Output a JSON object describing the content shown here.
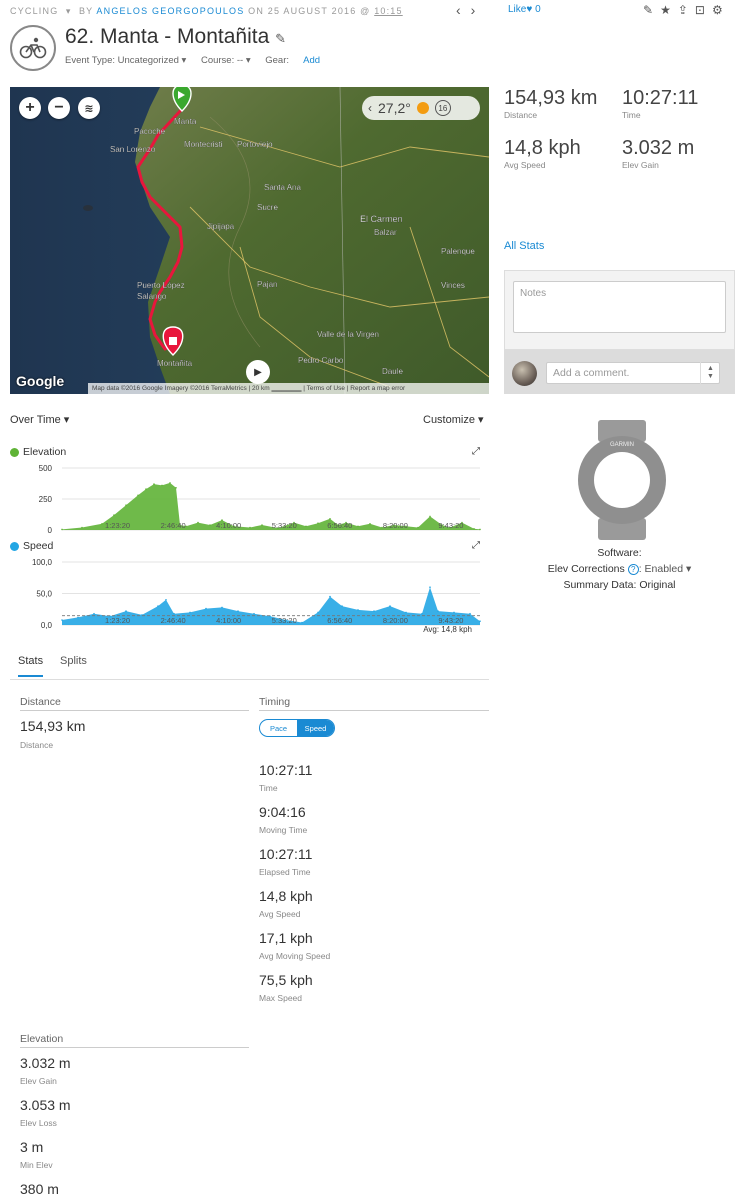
{
  "header": {
    "activity_type": "CYCLING",
    "by": "BY",
    "author": "ANGELOS GEORGOPOULOS",
    "date_prefix": "ON 25 AUGUST 2016 @",
    "time": "10:15",
    "like_label": "Like",
    "like_count": "0",
    "title": "62. Manta - Montañita",
    "event_type": "Event Type: Uncategorized ▾",
    "course": "Course: -- ▾",
    "gear_label": "Gear:",
    "gear_add": "Add"
  },
  "map": {
    "weather_temp": "27,2°",
    "wind_speed": "16",
    "google": "Google",
    "footer": "Map data ©2016 Google Imagery ©2016 TerraMetrics | 20 km ▁▁▁▁▁▁ | Terms of Use | Report a map error",
    "places": [
      {
        "name": "Manta"
      },
      {
        "name": "Pacoche"
      },
      {
        "name": "San Lorenzo"
      },
      {
        "name": "Montecristi"
      },
      {
        "name": "Portoviejo"
      },
      {
        "name": "Santa Ana"
      },
      {
        "name": "Sucre"
      },
      {
        "name": "El Carmen"
      },
      {
        "name": "Balzar"
      },
      {
        "name": "Jipijapa"
      },
      {
        "name": "Palenque"
      },
      {
        "name": "Puerto López"
      },
      {
        "name": "Salango"
      },
      {
        "name": "Pajan"
      },
      {
        "name": "Vinces"
      },
      {
        "name": "Valle de la Virgen"
      },
      {
        "name": "Pedro Carbo"
      },
      {
        "name": "Montañita"
      },
      {
        "name": "Daule"
      }
    ]
  },
  "summary": {
    "distance_value": "154,93 km",
    "distance_label": "Distance",
    "time_value": "10:27:11",
    "time_label": "Time",
    "avg_speed_value": "14,8 kph",
    "avg_speed_label": "Avg Speed",
    "elev_gain_value": "3.032 m",
    "elev_gain_label": "Elev Gain",
    "all_stats": "All Stats"
  },
  "notes": {
    "placeholder": "Notes",
    "comment_placeholder": "Add a comment."
  },
  "device": {
    "brand": "GARMIN",
    "software": "Software:",
    "elev_corrections": "Elev Corrections",
    "elev_status": ": Enabled ▾",
    "summary_data": "Summary Data: Original"
  },
  "charts": {
    "over_time": "Over Time ▾",
    "customize": "Customize ▾",
    "elevation_label": "Elevation",
    "speed_label": "Speed",
    "speed_avg": "Avg: 14,8 kph",
    "elevation_color": "#5fb336",
    "speed_color": "#23a6e4"
  },
  "chart_data": [
    {
      "type": "area",
      "title": "Elevation",
      "x_ticks": [
        "1:23:20",
        "2:46:40",
        "4:10:00",
        "5:33:20",
        "6:56:40",
        "8:20:00",
        "9:43:20"
      ],
      "y_ticks": [
        "500",
        "250",
        "0"
      ],
      "ylim": [
        0,
        500
      ],
      "x": [
        0,
        0.5,
        1,
        1.3,
        1.6,
        1.9,
        2.1,
        2.3,
        2.5,
        2.7,
        2.85,
        2.95,
        3.1,
        3.4,
        3.7,
        4.0,
        4.3,
        4.7,
        5.0,
        5.4,
        5.8,
        6.1,
        6.4,
        6.7,
        6.9,
        7.1,
        7.4,
        7.7,
        8.0,
        8.3,
        8.6,
        8.9,
        9.2,
        9.5,
        9.7,
        10.0,
        10.3,
        10.45
      ],
      "values": [
        5,
        20,
        50,
        120,
        200,
        280,
        330,
        370,
        360,
        380,
        340,
        40,
        30,
        60,
        40,
        80,
        30,
        20,
        40,
        15,
        60,
        30,
        55,
        90,
        40,
        60,
        30,
        50,
        20,
        40,
        30,
        20,
        110,
        40,
        20,
        60,
        10,
        5
      ]
    },
    {
      "type": "area",
      "title": "Speed",
      "x_ticks": [
        "1:23:20",
        "2:46:40",
        "4:10:00",
        "5:33:20",
        "6:56:40",
        "8:20:00",
        "9:43:20"
      ],
      "y_ticks": [
        "100,0",
        "50,0",
        "0,0"
      ],
      "ylim": [
        0,
        100
      ],
      "avg": 14.8,
      "x": [
        0,
        0.4,
        0.8,
        1.2,
        1.6,
        2.0,
        2.4,
        2.6,
        2.8,
        3.2,
        3.6,
        4.0,
        4.4,
        4.8,
        5.2,
        5.6,
        6.0,
        6.4,
        6.7,
        7.0,
        7.4,
        7.8,
        8.2,
        8.6,
        9.0,
        9.2,
        9.4,
        9.8,
        10.2,
        10.45
      ],
      "values": [
        8,
        12,
        18,
        14,
        22,
        16,
        30,
        40,
        18,
        20,
        26,
        28,
        22,
        18,
        14,
        8,
        4,
        20,
        45,
        30,
        24,
        22,
        30,
        20,
        18,
        60,
        22,
        20,
        18,
        6
      ]
    }
  ],
  "tabs": [
    {
      "label": "Stats"
    },
    {
      "label": "Splits"
    }
  ],
  "stats": {
    "distance_head": "Distance",
    "distance_value": "154,93 km",
    "distance_label": "Distance",
    "timing_head": "Timing",
    "pace": "Pace",
    "speed": "Speed",
    "timing": [
      {
        "value": "10:27:11",
        "label": "Time"
      },
      {
        "value": "9:04:16",
        "label": "Moving Time"
      },
      {
        "value": "10:27:11",
        "label": "Elapsed Time"
      },
      {
        "value": "14,8 kph",
        "label": "Avg Speed"
      },
      {
        "value": "17,1 kph",
        "label": "Avg Moving Speed"
      },
      {
        "value": "75,5 kph",
        "label": "Max Speed"
      }
    ],
    "elevation_head": "Elevation",
    "elevation": [
      {
        "value": "3.032 m",
        "label": "Elev Gain"
      },
      {
        "value": "3.053 m",
        "label": "Elev Loss"
      },
      {
        "value": "3 m",
        "label": "Min Elev"
      },
      {
        "value": "380 m",
        "label": ""
      }
    ]
  }
}
